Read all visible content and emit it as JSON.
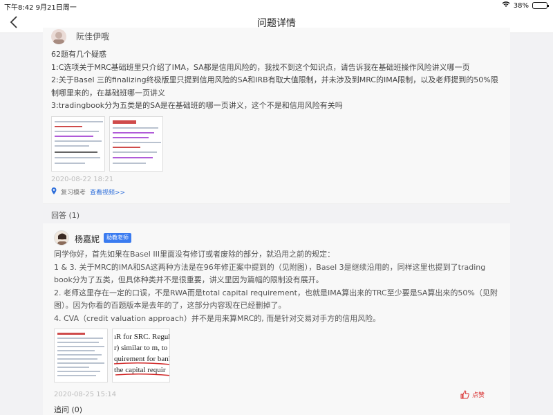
{
  "status_bar": {
    "time_date": "下午8:42  9月21日周一",
    "battery": "38%",
    "battery_level": 0.38
  },
  "nav": {
    "title": "问题详情"
  },
  "question": {
    "author": "阮佳伊哦",
    "lines": [
      "62题有几个疑惑",
      "1:C选项关于MRC基础班里只介绍了IMA，SA都是信用风险的，我找不到这个知识点，请告诉我在基础班操作风险讲义哪一页",
      "2:关于Basel 三的finalizing终极版里只提到信用风险的SA和IRB有取大值限制，并未涉及到MRC的IMA限制，以及老师提到的50%限制哪里来的，在基础班哪一页讲义",
      "3:tradingbook分为五类是的SA是在基础班的哪一页讲义，这个不是和信用风险有关吗"
    ],
    "date": "2020-08-22 18:21",
    "tag": "复习模考",
    "video_link": "查看视频>>"
  },
  "answers": {
    "section_label": "回答 (1)",
    "item": {
      "author": "杨嘉妮",
      "role": "助教老师",
      "lines": [
        "同学你好，首先如果在Basel III里面没有修订或者废除的部分，就沿用之前的规定：",
        "1 & 3. 关于MRC的IMA和SA这两种方法是在96年修正案中提到的（见附图），Basel 3是继续沿用的，同样这里也提到了trading book分为了五类，但具体种类并不是很重要，讲义里因为篇幅的限制没有展开。",
        "2. 老师这里存在一定的口误，不是RWA而是total capital requirement，也就是IMA算出来的TRC至少要是SA算出来的50%（见附图）。因为你看的百题版本是去年的了，这部分内容现在已经删掉了。",
        "4. CVA（credit valuation approach）并不是用来算MRC的, 而是针对交易对手方的信用风险。"
      ],
      "date": "2020-08-25 15:14",
      "like_label": "点赞",
      "comment_label": "追问 (0)",
      "thumb2_lines": [
        "ıR for SRC. Regul",
        "r) similar to m, to",
        "quirement for banl",
        "the capital requir"
      ]
    }
  },
  "colors": {
    "accent_blue": "#2f6fda",
    "like_red": "#d93030",
    "badge_blue": "#3a7bf0"
  }
}
